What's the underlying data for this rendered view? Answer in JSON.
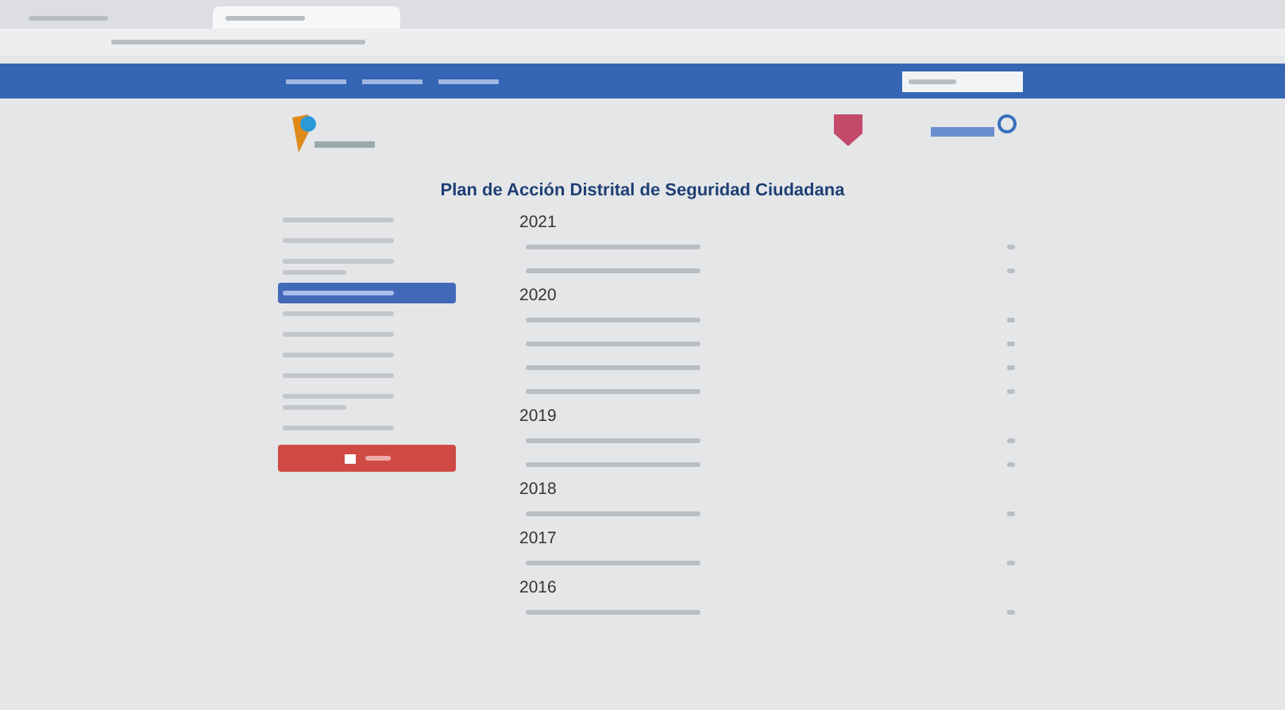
{
  "browser": {
    "tabs": [
      {
        "kind": "illegible",
        "selected": false
      },
      {
        "kind": "illegible",
        "selected": true
      }
    ]
  },
  "nav": {
    "items": [
      {
        "kind": "illegible"
      },
      {
        "kind": "illegible"
      },
      {
        "kind": "illegible"
      }
    ],
    "search": {
      "kind": "illegible"
    }
  },
  "title": "Plan de Acción Distrital de Seguridad Ciudadana",
  "sidebar": {
    "items": [
      {
        "kind": "short",
        "selected": false
      },
      {
        "kind": "short",
        "selected": false
      },
      {
        "kind": "wrapped",
        "selected": false
      },
      {
        "kind": "short",
        "selected": true
      },
      {
        "kind": "short",
        "selected": false
      },
      {
        "kind": "short",
        "selected": false
      },
      {
        "kind": "short",
        "selected": false
      },
      {
        "kind": "short",
        "selected": false
      },
      {
        "kind": "wrapped",
        "selected": false
      },
      {
        "kind": "short",
        "selected": false
      }
    ],
    "button": {
      "kind": "illegible"
    }
  },
  "sections": [
    {
      "year": "2021",
      "documents": [
        {
          "kind": "illegible"
        },
        {
          "kind": "illegible"
        }
      ]
    },
    {
      "year": "2020",
      "documents": [
        {
          "kind": "illegible"
        },
        {
          "kind": "illegible"
        },
        {
          "kind": "illegible"
        },
        {
          "kind": "illegible"
        }
      ]
    },
    {
      "year": "2019",
      "documents": [
        {
          "kind": "illegible"
        },
        {
          "kind": "illegible"
        }
      ]
    },
    {
      "year": "2018",
      "documents": [
        {
          "kind": "illegible"
        }
      ]
    },
    {
      "year": "2017",
      "documents": [
        {
          "kind": "illegible"
        }
      ]
    },
    {
      "year": "2016",
      "documents": [
        {
          "kind": "illegible"
        }
      ]
    }
  ]
}
